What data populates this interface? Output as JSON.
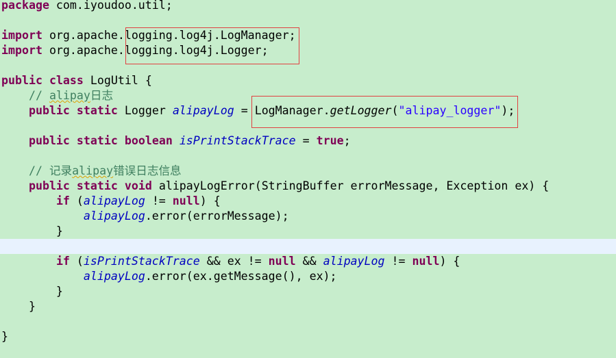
{
  "editor": {
    "current_line": 16,
    "lines": [
      [
        [
          "package",
          "kw"
        ],
        [
          " com.iyoudoo.util;",
          ""
        ]
      ],
      [],
      [
        [
          "import",
          "kw"
        ],
        [
          " org.apache.logging.log4j.LogManager;",
          ""
        ]
      ],
      [
        [
          "import",
          "kw"
        ],
        [
          " org.apache.logging.log4j.Logger;",
          ""
        ]
      ],
      [],
      [
        [
          "public",
          "kw"
        ],
        [
          " ",
          ""
        ],
        [
          "class",
          "kw"
        ],
        [
          " LogUtil {",
          ""
        ]
      ],
      [
        [
          "    ",
          ""
        ],
        [
          "// ",
          "cm"
        ],
        [
          "alipay",
          "cm sq"
        ],
        [
          "日志",
          "cm"
        ]
      ],
      [
        [
          "    ",
          ""
        ],
        [
          "public",
          "kw"
        ],
        [
          " ",
          ""
        ],
        [
          "static",
          "kw"
        ],
        [
          " Logger ",
          ""
        ],
        [
          "alipayLog",
          "fld"
        ],
        [
          " = LogManager.",
          ""
        ],
        [
          "getLogger",
          "it"
        ],
        [
          "(",
          ""
        ],
        [
          "\"alipay_logger\"",
          "str"
        ],
        [
          ");",
          ""
        ]
      ],
      [],
      [
        [
          "    ",
          ""
        ],
        [
          "public",
          "kw"
        ],
        [
          " ",
          ""
        ],
        [
          "static",
          "kw"
        ],
        [
          " ",
          ""
        ],
        [
          "boolean",
          "kw"
        ],
        [
          " ",
          ""
        ],
        [
          "isPrintStackTrace",
          "fld"
        ],
        [
          " = ",
          ""
        ],
        [
          "true",
          "kw"
        ],
        [
          ";",
          ""
        ]
      ],
      [],
      [
        [
          "    ",
          ""
        ],
        [
          "// 记录",
          "cm"
        ],
        [
          "alipay",
          "cm sq"
        ],
        [
          "错误日志信息",
          "cm"
        ]
      ],
      [
        [
          "    ",
          ""
        ],
        [
          "public",
          "kw"
        ],
        [
          " ",
          ""
        ],
        [
          "static",
          "kw"
        ],
        [
          " ",
          ""
        ],
        [
          "void",
          "kw"
        ],
        [
          " alipayLogError(StringBuffer errorMessage, Exception ex) {",
          ""
        ]
      ],
      [
        [
          "        ",
          ""
        ],
        [
          "if",
          "kw"
        ],
        [
          " (",
          ""
        ],
        [
          "alipayLog",
          "fld"
        ],
        [
          " != ",
          ""
        ],
        [
          "null",
          "kw"
        ],
        [
          ") {",
          ""
        ]
      ],
      [
        [
          "            ",
          ""
        ],
        [
          "alipayLog",
          "fld"
        ],
        [
          ".error(errorMessage);",
          ""
        ]
      ],
      [
        [
          "        }",
          ""
        ]
      ],
      [],
      [
        [
          "        ",
          ""
        ],
        [
          "if",
          "kw"
        ],
        [
          " (",
          ""
        ],
        [
          "isPrintStackTrace",
          "fld"
        ],
        [
          " && ex != ",
          ""
        ],
        [
          "null",
          "kw"
        ],
        [
          " && ",
          ""
        ],
        [
          "alipayLog",
          "fld"
        ],
        [
          " != ",
          ""
        ],
        [
          "null",
          "kw"
        ],
        [
          ") {",
          ""
        ]
      ],
      [
        [
          "            ",
          ""
        ],
        [
          "alipayLog",
          "fld"
        ],
        [
          ".error(ex.getMessage(), ex);",
          ""
        ]
      ],
      [
        [
          "        }",
          ""
        ]
      ],
      [
        [
          "    }",
          ""
        ]
      ],
      [],
      [
        [
          "}",
          ""
        ]
      ]
    ]
  },
  "colors": {
    "background": "#c7edcc",
    "keyword": "#7f0055",
    "field": "#0000c0",
    "string": "#2a00ff",
    "comment": "#3f7f5f",
    "highlight_box": "#e04040",
    "current_line": "#e8f2fe"
  }
}
